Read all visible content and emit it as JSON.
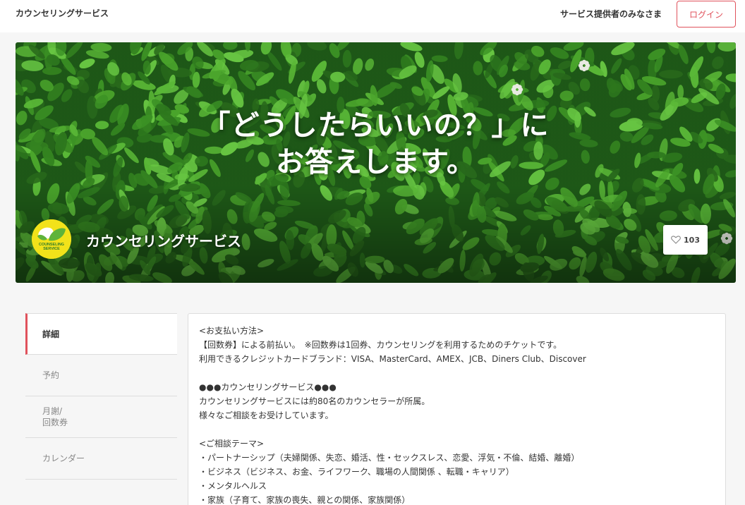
{
  "header": {
    "brand": "カウンセリングサービス",
    "provider_link": "サービス提供者のみなさま",
    "login_label": "ログイン"
  },
  "hero": {
    "title_line1": "「どうしたらいいの？」に",
    "title_line2": "お答えします。",
    "shop_name": "カウンセリングサービス",
    "logo_text_line1": "COUNSELING",
    "logo_text_line2": "SERVICE",
    "like_count": "103"
  },
  "nav": {
    "items": [
      {
        "label": "詳細"
      },
      {
        "label": "予約"
      },
      {
        "label_line1": "月謝/",
        "label_line2": "回数券"
      },
      {
        "label": "カレンダー"
      }
    ]
  },
  "content": {
    "lines": [
      "<お支払い方法>",
      "【回数券】による前払い。　※回数券は1回券、カウンセリングを利用するためのチケットです。",
      "利用できるクレジットカードブランド：VISA、MasterCard、AMEX、JCB、Diners Club、Discover",
      "",
      "●●●カウンセリングサービス●●●",
      "カウンセリングサービスには約80名のカウンセラーが所属。",
      "様々なご相談をお受けしています。",
      "",
      "<ご相談テーマ>",
      "・パートナーシップ（夫婦関係、失恋、婚活、性・セックスレス、恋愛、浮気・不倫、結婚、離婚）",
      "・ビジネス（ビジネス、お金、ライフワーク、職場の人間関係 、転職・キャリア）",
      "・メンタルヘルス",
      "・家族（子育て、家族の喪失、親との関係、家族関係）"
    ]
  },
  "colors": {
    "accent": "#e0525c",
    "leaf_dark": "#1f5c18",
    "leaf_light": "#5fc23a",
    "logo_yellow": "#f2e21a"
  },
  "icons": {
    "like": "heart-outline-icon",
    "logo": "leaf-logo-icon"
  }
}
